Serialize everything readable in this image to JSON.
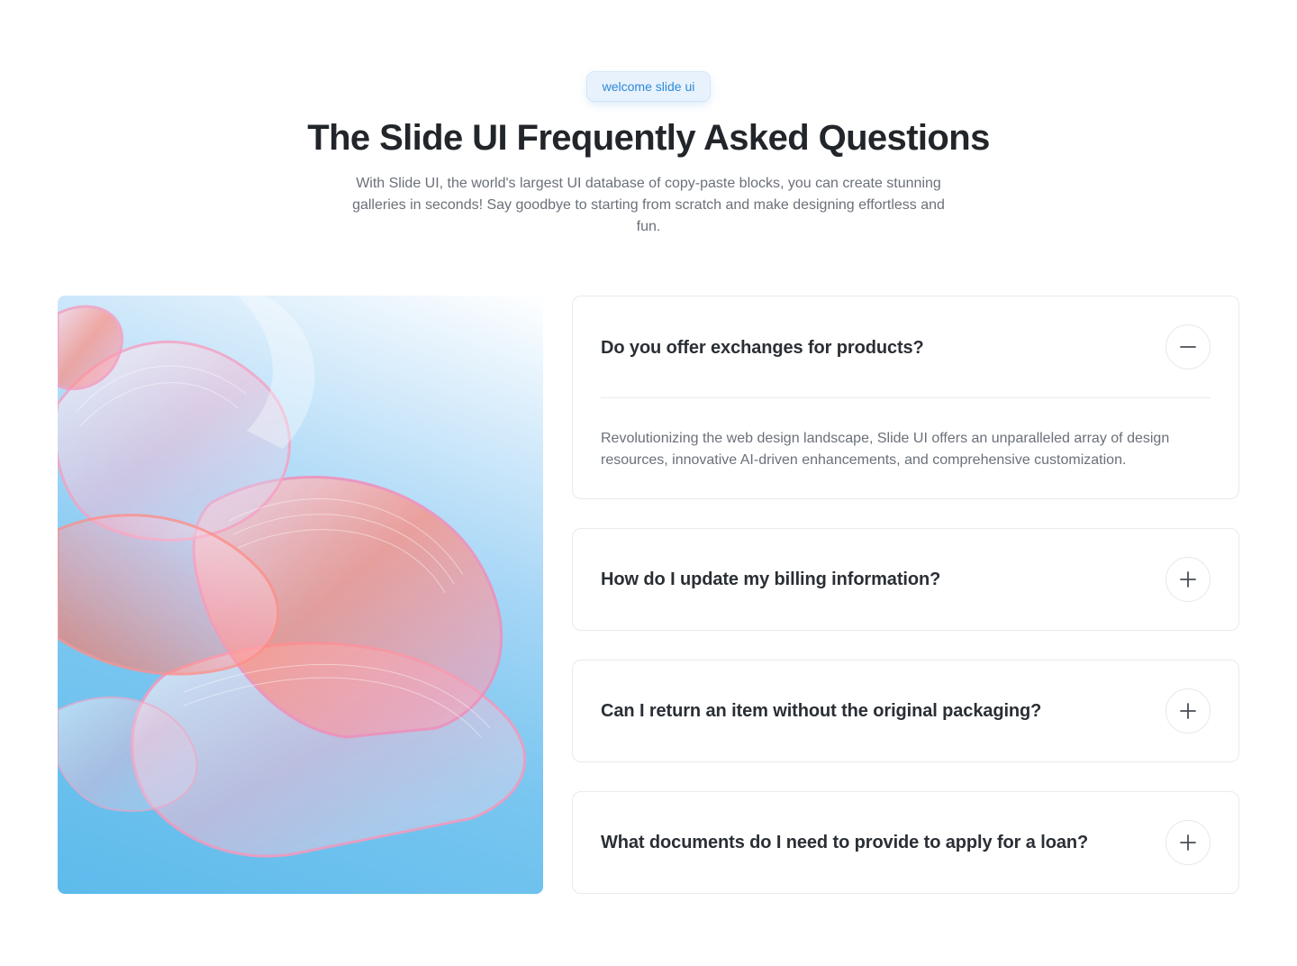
{
  "badge": "welcome slide ui",
  "title": "The Slide UI Frequently Asked Questions",
  "subtitle": "With Slide UI, the world's largest UI database of copy-paste blocks, you can create stunning galleries in seconds! Say goodbye to starting from scratch and make designing effortless and fun.",
  "faqs": [
    {
      "question": "Do you offer exchanges for products?",
      "answer": "Revolutionizing the web design landscape, Slide UI offers an unparalleled array of design resources, innovative AI-driven enhancements, and comprehensive customization.",
      "expanded": true,
      "icon": "minus-icon"
    },
    {
      "question": "How do I update my billing information?",
      "expanded": false,
      "icon": "plus-icon"
    },
    {
      "question": "Can I return an item without the original packaging?",
      "expanded": false,
      "icon": "plus-icon"
    },
    {
      "question": "What documents do I need to provide to apply for a loan?",
      "expanded": false,
      "icon": "plus-icon"
    }
  ],
  "colors": {
    "accent": "#2d89d8",
    "badge_bg": "#e8f2fd",
    "heading": "#22262b",
    "body_text": "#6b7079",
    "border": "#e8eaed"
  }
}
